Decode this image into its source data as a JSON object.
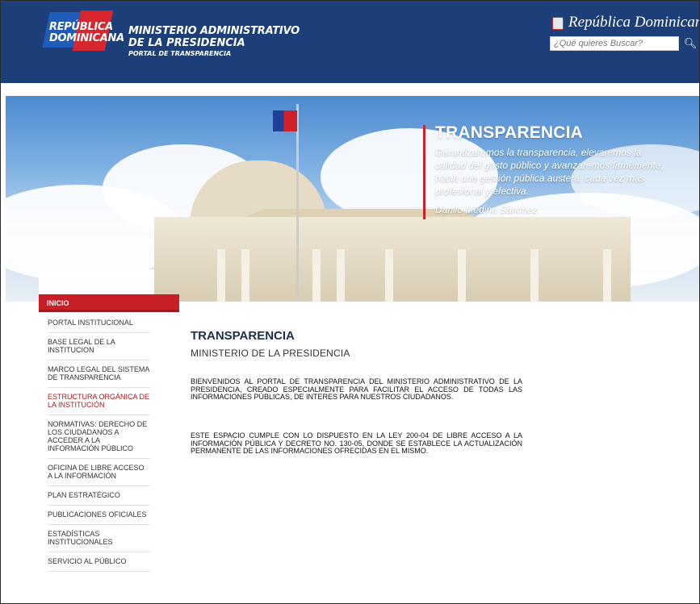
{
  "header": {
    "logo_text": [
      "REPÚBLICA",
      "DOMINICANA"
    ],
    "ministry_line1": "MINISTERIO ADMINISTRATIVO",
    "ministry_line2": "DE LA PRESIDENCIA",
    "ministry_line3": "PORTAL DE TRANSPARENCIA",
    "republica_text": "República Dominicana",
    "search_placeholder": "¿Qué quieres Buscar?",
    "search_icon": "search-icon"
  },
  "banner": {
    "title": "TRANSPARENCIA",
    "quote": "Garantizaremos la transparencia, elevaremos la calidad del gasto público y avanzaremos firmemente, hacia una gestión pública austera, cada vez más profesional y efectiva.",
    "author": "Danilo Medina Sánchez"
  },
  "sidebar": {
    "active_tab": "INICIO",
    "items": [
      {
        "label": "PORTAL INSTITUCIONAL",
        "active": false
      },
      {
        "label": "BASE LEGAL DE LA INSTITUCION",
        "active": false
      },
      {
        "label": "MARCO LEGAL DEL SISTEMA DE TRANSPARENCIA",
        "active": false
      },
      {
        "label": "ESTRUCTURA ORGÁNICA DE LA INSTITUCIÓN",
        "active": true
      },
      {
        "label": "NORMATIVAS: DERECHO DE LOS CIUDADANOS A ACCEDER A LA INFORMACIÓN PÚBLICO",
        "active": false
      },
      {
        "label": "OFICINA DE LIBRE ACCESO A LA INFORMACIÓN",
        "active": false
      },
      {
        "label": "PLAN ESTRATÉGICO",
        "active": false
      },
      {
        "label": "PUBLICACIONES OFICIALES",
        "active": false
      },
      {
        "label": "ESTADÍSTICAS INSTITUCIONALES",
        "active": false
      },
      {
        "label": "SERVICIO AL PÚBLICO",
        "active": false
      }
    ]
  },
  "main": {
    "title": "TRANSPARENCIA",
    "subtitle": "MINISTERIO DE LA PRESIDENCIA",
    "paragraph1": "BIENVENIDOS AL PORTAL DE TRANSPARENCIA DEL MINISTERIO ADMINISTRATIVO DE LA PRESIDENCIA, CREADO ESPECIALMENTE PARA FACILITAR EL ACCESO DE TODAS LAS INFORMACIONES PÚBLICAS, DE INTERES PARA NUESTROS CIUDADANOS.",
    "paragraph2": "ESTE ESPACIO CUMPLE CON LO DISPUESTO EN LA LEY 200-04 DE LIBRE ACCESO A LA INFORMACIÓN PÚBLICA Y DECRETO NO. 130-05, DONDE SE ESTABLECE LA ACTUALIZACIÓN PERMANENTE DE LAS INFORMACIONES OFRECIDAS EN EL MISMO."
  },
  "colors": {
    "header_blue": "#1c3f7a",
    "accent_red": "#c81e25"
  }
}
